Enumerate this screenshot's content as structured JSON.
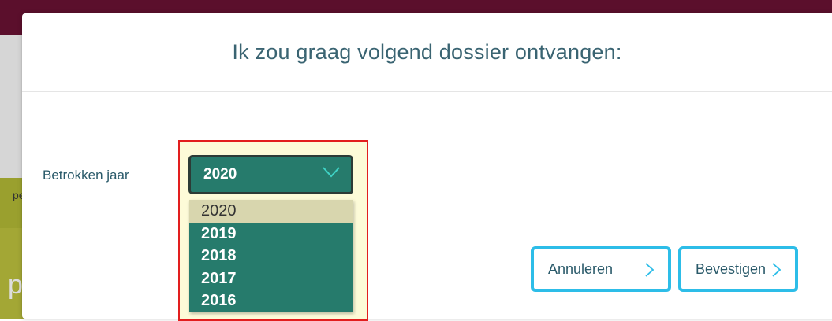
{
  "background": {
    "letter_left": "pe",
    "letter_bottom": "p"
  },
  "modal": {
    "title": "Ik zou graag volgend dossier ontvangen:",
    "field_label": "Betrokken jaar",
    "select": {
      "selected_value": "2020",
      "options": [
        "2020",
        "2019",
        "2018",
        "2017",
        "2016"
      ]
    },
    "buttons": {
      "cancel": "Annuleren",
      "confirm": "Bevestigen"
    }
  },
  "colors": {
    "title_text": "#3a6472",
    "select_bg": "#267b6c",
    "highlight_border": "#e21e1e",
    "button_border": "#2dbde8",
    "topbar": "#5b0f2c"
  },
  "icons": {
    "select": "chevron-down-icon",
    "buttons": "chevron-right-icon"
  }
}
